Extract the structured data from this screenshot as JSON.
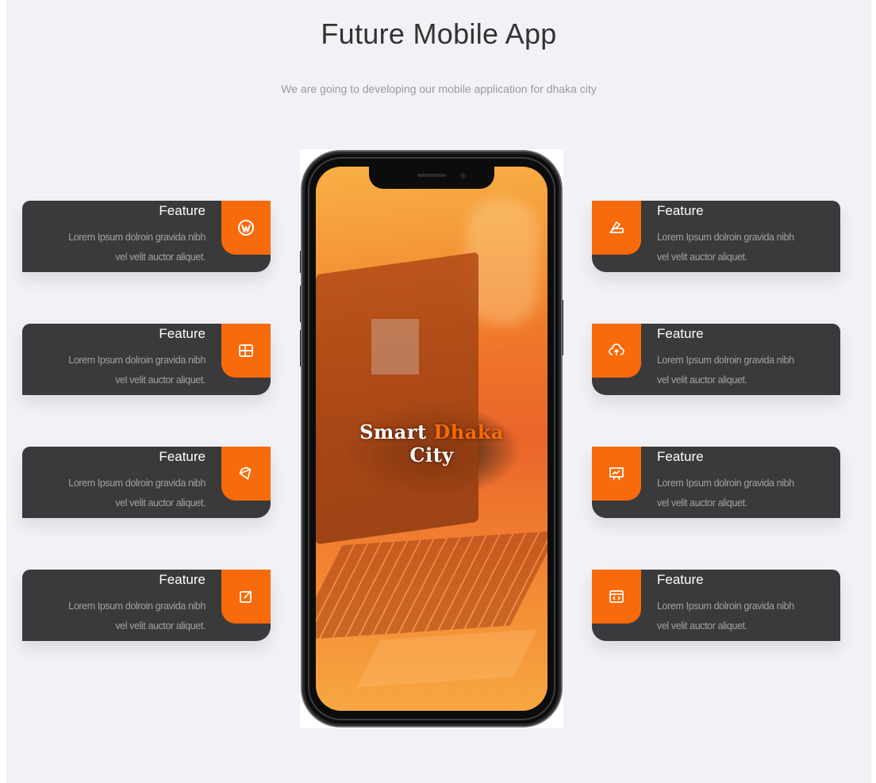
{
  "header": {
    "title": "Future Mobile App",
    "subtitle": "We are going to developing our mobile application for dhaka city"
  },
  "features_left": [
    {
      "title": "Feature",
      "desc_line1": "Lorem Ipsum dolroin gravida nibh",
      "desc_line2": "vel velit auctor aliquet.",
      "icon": "wordpress-icon"
    },
    {
      "title": "Feature",
      "desc_line1": "Lorem Ipsum dolroin gravida nibh",
      "desc_line2": "vel velit auctor aliquet.",
      "icon": "layout-icon"
    },
    {
      "title": "Feature",
      "desc_line1": "Lorem Ipsum dolroin gravida nibh",
      "desc_line2": "vel velit auctor aliquet.",
      "icon": "diamond-icon"
    },
    {
      "title": "Feature",
      "desc_line1": "Lorem Ipsum dolroin gravida nibh",
      "desc_line2": "vel velit auctor aliquet.",
      "icon": "edit-icon"
    }
  ],
  "features_right": [
    {
      "title": "Feature",
      "desc_line1": "Lorem Ipsum dolroin gravida nibh",
      "desc_line2": "vel velit auctor aliquet.",
      "icon": "palette-icon"
    },
    {
      "title": "Feature",
      "desc_line1": "Lorem Ipsum dolroin gravida nibh",
      "desc_line2": "vel velit auctor aliquet.",
      "icon": "cloud-sync-icon"
    },
    {
      "title": "Feature",
      "desc_line1": "Lorem Ipsum dolroin gravida nibh",
      "desc_line2": "vel velit auctor aliquet.",
      "icon": "presentation-chart-icon"
    },
    {
      "title": "Feature",
      "desc_line1": "Lorem Ipsum dolroin gravida nibh",
      "desc_line2": "vel velit auctor aliquet.",
      "icon": "code-window-icon"
    }
  ],
  "phone": {
    "app_name_part1": "Smart ",
    "app_name_part2": "Dhaka",
    "app_name_part3": "City"
  },
  "colors": {
    "accent": "#f96a0a",
    "card_bg": "#3a3a3c",
    "page_bg": "#f1f2f5"
  }
}
